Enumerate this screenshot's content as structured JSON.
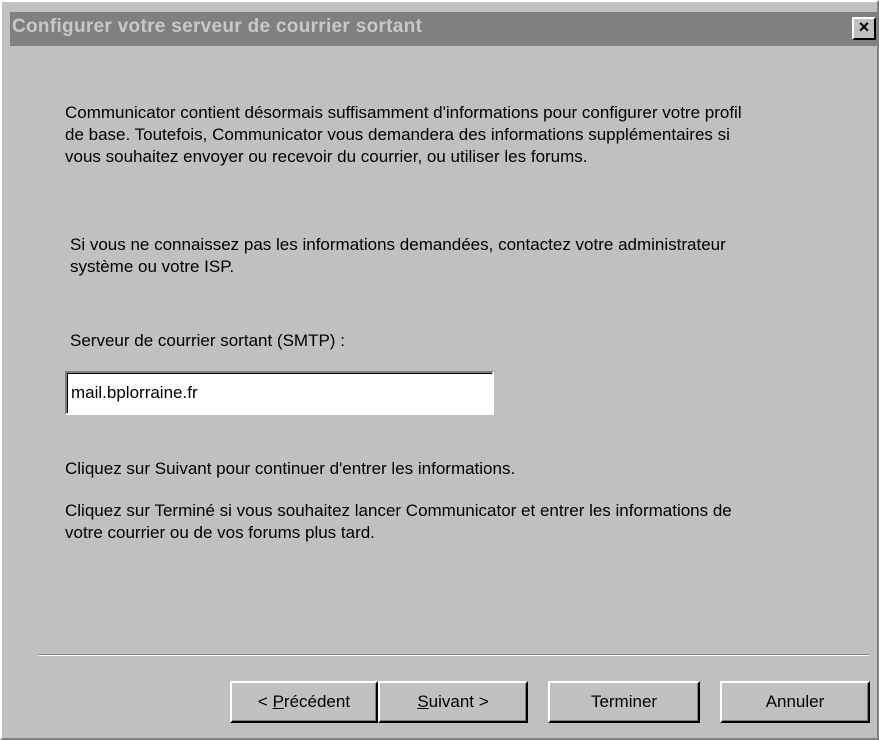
{
  "window": {
    "title": "Configurer votre serveur de courrier sortant",
    "close_label": "×"
  },
  "content": {
    "intro": "Communicator contient désormais suffisamment d'informations pour configurer votre profil de base. Toutefois, Communicator vous demandera des informations supplémentaires si vous souhaitez envoyer ou recevoir du courrier, ou utiliser les forums.",
    "contact": "Si vous ne connaissez pas les informations demandées, contactez votre administrateur système ou votre ISP.",
    "smtp_label": "Serveur de courrier sortant (SMTP) :",
    "smtp_value": "mail.bplorraine.fr",
    "next_info": "Cliquez sur Suivant pour continuer d'entrer les informations.",
    "finish_info": "Cliquez sur Terminé si vous souhaitez lancer Communicator et entrer les informations de votre courrier ou de vos forums plus tard."
  },
  "buttons": {
    "prev_prefix": "< ",
    "prev_mnemonic": "P",
    "prev_rest": "récédent",
    "next_mnemonic": "S",
    "next_rest": "uivant >",
    "finish": "Terminer",
    "cancel": "Annuler"
  },
  "colors": {
    "face": "#c0c0c0",
    "titlebar_inactive": "#808080",
    "title_text": "#c8c8c8"
  }
}
